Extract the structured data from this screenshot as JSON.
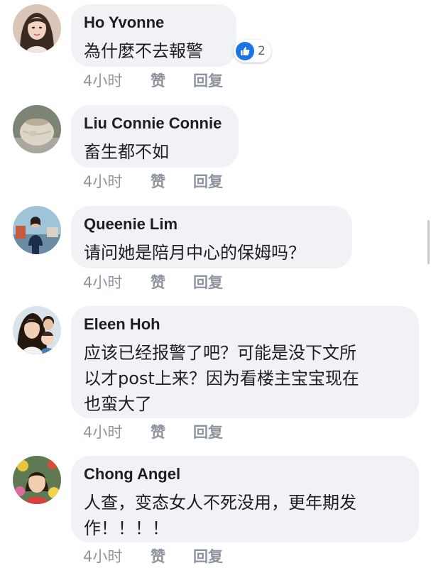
{
  "comments": [
    {
      "author": "Ho Yvonne",
      "text": "為什麼不去報警",
      "time": "4小时",
      "like_label": "赞",
      "reply_label": "回复",
      "reactions": {
        "icon": "thumbs-up-icon",
        "count": "2"
      },
      "avatar": "woman-portrait-avatar"
    },
    {
      "author": "Liu Connie Connie",
      "text": "畜生都不如",
      "time": "4小时",
      "like_label": "赞",
      "reply_label": "回复",
      "avatar": "pottery-jar-avatar"
    },
    {
      "author": "Queenie Lim",
      "text": "请问她是陪月中心的保姆吗？",
      "time": "4小时",
      "like_label": "赞",
      "reply_label": "回复",
      "avatar": "woman-by-harbor-avatar"
    },
    {
      "author": "Eleen Hoh",
      "text": "应该已经报警了吧？可能是没下文所\n以才post上来？因为看楼主宝宝现在\n也蛮大了",
      "time": "4小时",
      "like_label": "赞",
      "reply_label": "回复",
      "avatar": "family-selfie-avatar"
    },
    {
      "author": "Chong Angel",
      "text": "人查，变态女人不死没用，更年期发\n作！！！！",
      "time": "4小时",
      "like_label": "赞",
      "reply_label": "回复",
      "avatar": "woman-with-flowers-avatar"
    }
  ],
  "colors": {
    "bubble": "#f1f2f6",
    "meta_text": "#8d949e",
    "like_blue": "#1b74e4"
  }
}
